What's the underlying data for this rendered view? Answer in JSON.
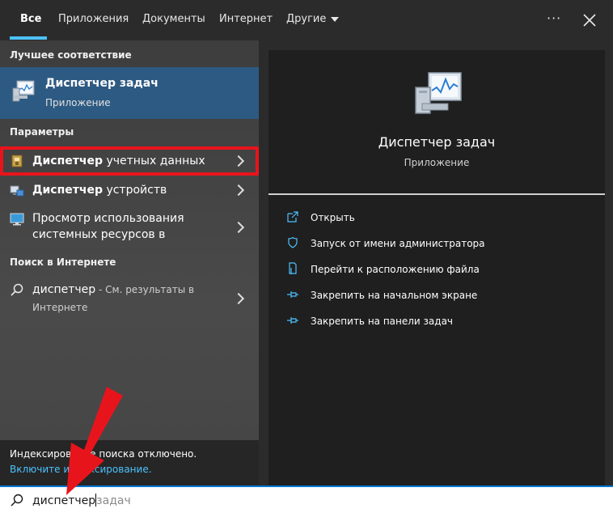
{
  "tabs": [
    {
      "label": "Все"
    },
    {
      "label": "Приложения"
    },
    {
      "label": "Документы"
    },
    {
      "label": "Интернет"
    },
    {
      "label": "Другие"
    }
  ],
  "more_label": "···",
  "left": {
    "best_match_header": "Лучшее соответствие",
    "best_match": {
      "title": "Диспетчер задач",
      "subtitle": "Приложение"
    },
    "settings_header": "Параметры",
    "settings": [
      {
        "bold": "Диспетчер",
        "rest": " учетных данных"
      },
      {
        "bold": "Диспетчер",
        "rest": " устройств"
      },
      {
        "line1": "Просмотр использования",
        "line2": "системных ресурсов в"
      }
    ],
    "web_header": "Поиск в Интернете",
    "web": {
      "query": "диспетчер",
      "suffix": " - См. результаты в",
      "line2": "Интернете"
    },
    "indexing_off": "Индексирование поиска отключено.",
    "indexing_link": "Включите индексирование."
  },
  "preview": {
    "title": "Диспетчер задач",
    "subtitle": "Приложение",
    "actions": [
      {
        "label": "Открыть",
        "icon": "open-icon"
      },
      {
        "label": "Запуск от имени администратора",
        "icon": "shield-icon"
      },
      {
        "label": "Перейти к расположению файла",
        "icon": "file-location-icon"
      },
      {
        "label": "Закрепить на начальном экране",
        "icon": "pin-icon"
      },
      {
        "label": "Закрепить на панели задач",
        "icon": "pin-icon"
      }
    ]
  },
  "search": {
    "typed": "диспетчер",
    "suggestion": "задач"
  },
  "colors": {
    "accent": "#4cc2ff",
    "selected": "#2d5a82",
    "highlight_box": "#e8141c",
    "annotation_arrow": "#e8141c"
  }
}
